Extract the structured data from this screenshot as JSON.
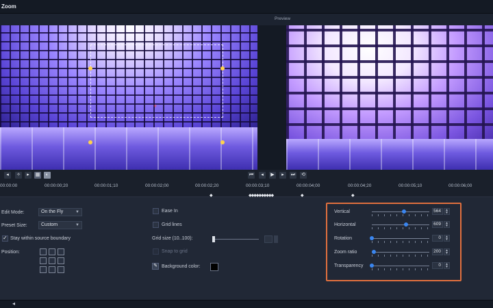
{
  "window": {
    "title": "Zoom"
  },
  "preview": {
    "label": "Preview"
  },
  "timeline": {
    "ticks": [
      "00:00:00",
      "00:00:00;20",
      "00:00:01;10",
      "00:00:02;00",
      "00:00:02;20",
      "00:00:03;10",
      "00:00:04;00",
      "00:00:04;20",
      "00:00:05;10",
      "00:00:06;00"
    ],
    "keyframes": "◆◆◆◆◆◆◆◆◆◆"
  },
  "settings": {
    "edit_mode_label": "Edit Mode:",
    "edit_mode_value": "On the Fly",
    "preset_size_label": "Preset Size:",
    "preset_size_value": "Custom",
    "stay_within_label": "Stay within source boundary",
    "position_label": "Position:",
    "ease_in_label": "Ease In",
    "grid_lines_label": "Grid lines",
    "grid_size_label": "Grid size (10..100):",
    "snap_to_grid_label": "Snap to grid",
    "background_color_label": "Background color:"
  },
  "attributes": [
    {
      "label": "Vertical",
      "value": "564",
      "level": 0.56
    },
    {
      "label": "Horizontal",
      "value": "609",
      "level": 0.6
    },
    {
      "label": "Rotation",
      "value": "0",
      "level": 0
    },
    {
      "label": "Zoom ratio",
      "value": "200",
      "level": 0.03
    },
    {
      "label": "Transparency",
      "value": "0",
      "level": 0
    }
  ],
  "colors": {
    "accent_highlight": "#e2703e",
    "slider_thumb": "#3a86f0",
    "background": "#1c2330"
  }
}
